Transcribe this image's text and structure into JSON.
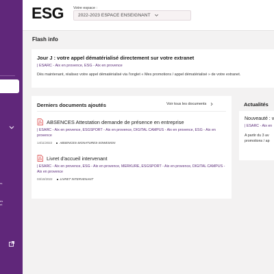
{
  "colors": {
    "sidebar": "#60277a",
    "accent": "#5a2a78",
    "background": "#f3f2f2"
  },
  "sidebar": {
    "fragment_1": "rs",
    "fragment_2_line1": "es",
    "fragment_2_line2": "nt",
    "icons": [
      "chevron-down-icon",
      "external-link-icon"
    ]
  },
  "header": {
    "logo": "ESG",
    "space_label": "Votre espace :",
    "space_value": "2022-2023 ESPACE ENSEIGNANT"
  },
  "flash": {
    "section_title": "Flash info",
    "item_title": "Jour J : votre appel dématérialisé directement sur votre extranet",
    "item_tags": "| ESARC - Aix en provence, ESG - Aix en provence",
    "item_body": "Dès maintenant, réalisez votre appel dématérialisé via l'onglet « Mes promotions / appel dématérialisé » de votre extranet."
  },
  "documents": {
    "section_title": "Derniers documents ajoutés",
    "see_all": "Voir tous les documents",
    "items": [
      {
        "title": "ABSENCES Attestation demande de présence en entreprise",
        "tags": "| ESARC - Aix en provence, ESGSPORT - Aix en provence, DIGITAL CAMPUS - Aix en provence, ESG - Aix en provence",
        "date": "14/11/2022",
        "keyword": "ABSENCES-SIGNATURES-SOWESIGN"
      },
      {
        "title": "Livret d'accueil intervenant",
        "tags": "| ESARC - Aix en provence, ESG - Aix en provence, MERKURE, ESGSPORT - Aix en provence, DIGITAL CAMPUS - Aix en provence",
        "date": "03/10/2022",
        "keyword": "LIVRET INTERVENANT"
      }
    ]
  },
  "news": {
    "section_title": "Actualités",
    "item_title": "Nouveauté : v",
    "item_tags": "| ESARC - Aix en",
    "item_body_line1": "A partir du 3 av",
    "item_body_line2": "promotions / ap"
  }
}
